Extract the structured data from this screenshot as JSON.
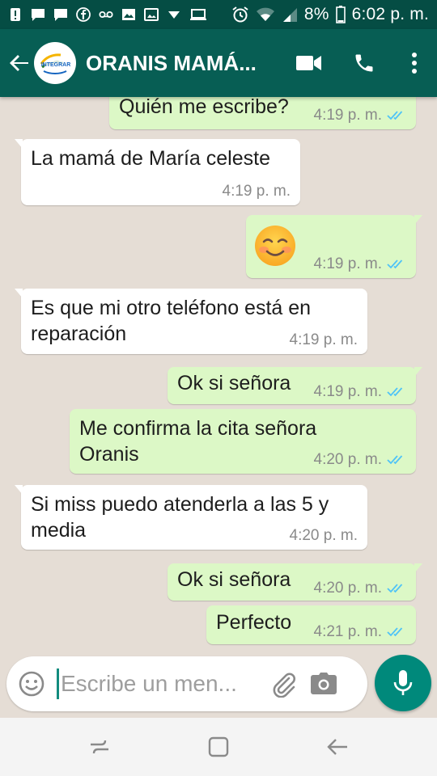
{
  "status_bar": {
    "battery": "8%",
    "time": "6:02 p. m.",
    "left_icons": [
      "alert-icon",
      "chat-icon",
      "chat-icon",
      "facebook-icon",
      "voicemail-icon",
      "image-icon",
      "gallery-icon",
      "dropdown-icon",
      "laptop-icon"
    ],
    "right_icons": [
      "alarm-icon",
      "wifi-icon",
      "signal-icon",
      "battery-icon"
    ]
  },
  "header": {
    "contact_name": "ORANIS MAMÁ...",
    "avatar_text": "INTEGRAR",
    "icons": [
      "back-arrow-icon",
      "video-call-icon",
      "phone-icon",
      "more-vert-icon"
    ]
  },
  "messages": [
    {
      "direction": "out",
      "text": "Quién me escribe?",
      "time": "4:19 p. m."
    },
    {
      "direction": "in",
      "text": "La mamá de María celeste",
      "time": "4:19 p. m."
    },
    {
      "direction": "out",
      "text": "☺️",
      "time": "4:19 p. m."
    },
    {
      "direction": "in",
      "text": "Es que mi otro teléfono está en reparación",
      "time": "4:19 p. m."
    },
    {
      "direction": "out",
      "text": "Ok si señora",
      "time": "4:19 p. m."
    },
    {
      "direction": "out",
      "text": "Me confirma la cita señora Oranis",
      "time": "4:20 p. m."
    },
    {
      "direction": "in",
      "text": "Si miss puedo atenderla a las 5 y media",
      "time": "4:20 p. m."
    },
    {
      "direction": "out",
      "text": "Ok si señora",
      "time": "4:20 p. m."
    },
    {
      "direction": "out",
      "text": "Perfecto",
      "time": "4:21 p. m."
    }
  ],
  "composer": {
    "placeholder": "Escribe un men...",
    "icons": [
      "emoji-icon",
      "attach-icon",
      "camera-icon",
      "mic-icon"
    ]
  },
  "nav_bar": {
    "icons": [
      "recents-icon",
      "home-icon",
      "back-icon"
    ]
  },
  "colors": {
    "status_bar": "#054d44",
    "toolbar": "#075e54",
    "chat_bg": "#e5ddd5",
    "outgoing": "#dcf8c6",
    "incoming": "#ffffff",
    "read_tick": "#4fc3f7",
    "fab": "#00897b"
  }
}
